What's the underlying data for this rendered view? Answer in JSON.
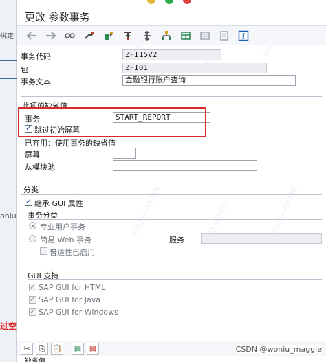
{
  "left_strip": {
    "frag1": "绑定",
    "frag2": "oniu_",
    "frag3": "过空"
  },
  "window": {
    "title": "更改 参数事务"
  },
  "toolbar": {
    "back_icon": "back-arrow-icon",
    "forward_icon": "forward-arrow-icon"
  },
  "header": {
    "tcode_label": "事务代码",
    "tcode_value": "ZFI15V2",
    "package_label": "包",
    "package_value": "ZFI01",
    "text_label": "事务文本",
    "text_value": "金融银行账户查询"
  },
  "defaults": {
    "section_title": "此项的缺省值",
    "transaction_label": "事务",
    "transaction_value": "START_REPORT",
    "skip_screen_label": "跳过初始屏幕",
    "skip_screen_checked": true,
    "obsolete_label": "已弃用：使用事务的缺省值",
    "screen_label": "屏幕",
    "screen_value": "",
    "module_pool_label": "从模块池",
    "module_pool_value": ""
  },
  "classification": {
    "section_title": "分类",
    "inherit_gui_label": "继承 GUI 属性",
    "inherit_gui_checked": true,
    "tx_class_title": "事务分类",
    "pro_user_label": "专业用户事务",
    "simple_web_label": "简易 Web 事务",
    "service_label": "服务",
    "service_value": "",
    "pervasive_label": "普适性已启用"
  },
  "gui_support": {
    "section_title": "GUI 支持",
    "html_label": "SAP GUI for HTML",
    "java_label": "SAP GUI for Java",
    "windows_label": "SAP GUI for Windows"
  },
  "bottom": {
    "footer_label": "缺省值"
  },
  "watermark": {
    "text": "CSDN @woniu_maggie",
    "bg_text": "YISZ0-WYXJN"
  },
  "colors": {
    "highlight": "#d62a2a",
    "info_icon": "#1a5fb4"
  }
}
